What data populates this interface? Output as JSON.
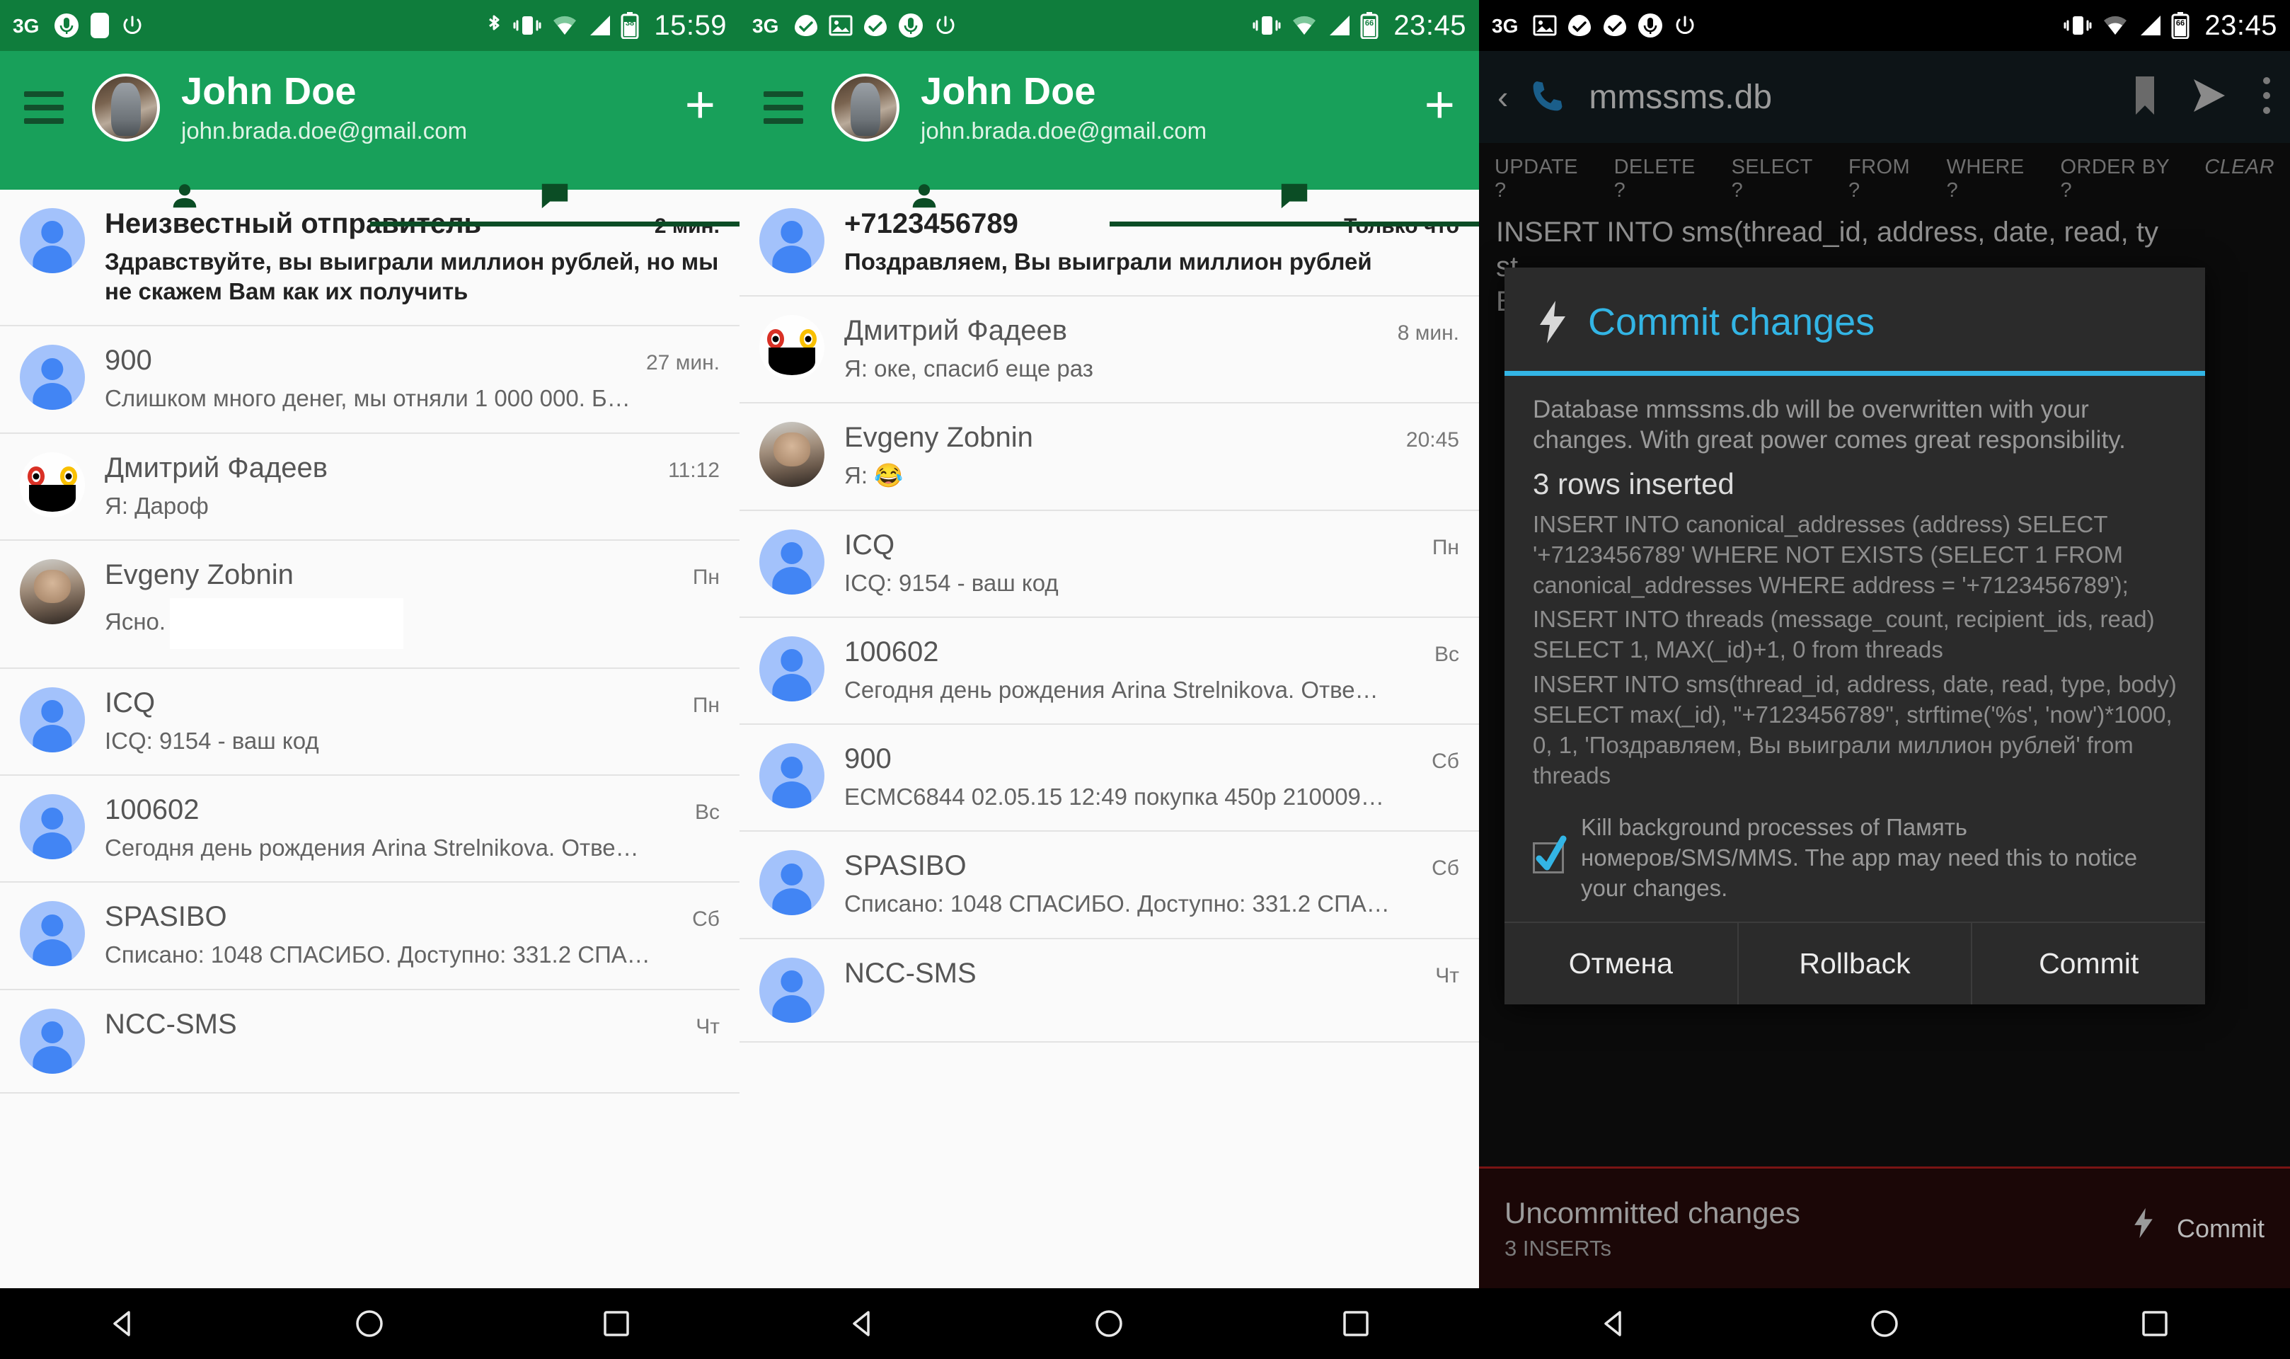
{
  "panel1": {
    "status_bar": {
      "time": "15:59",
      "battery_level": "38",
      "icons": [
        "3g-icon",
        "microphone-icon",
        "sim-card-icon",
        "power-icon",
        "bluetooth-icon",
        "vibrate-icon",
        "wifi-icon",
        "signal-icon",
        "battery-icon"
      ]
    },
    "header": {
      "name": "John Doe",
      "email": "john.brada.doe@gmail.com",
      "menu_icon": "hamburger-menu-icon",
      "add_icon": "plus-icon",
      "avatar": "user-avatar"
    },
    "tabs": [
      {
        "icon": "person-icon",
        "active": false
      },
      {
        "icon": "message-icon",
        "active": true
      }
    ],
    "messages": [
      {
        "sender": "Неизвестный отправитель",
        "time": "2 мин.",
        "snippet": "Здравствуйте, вы выиграли миллион рублей, но мы не скажем Вам как их получить",
        "unread": true,
        "avatar": "default-person-avatar",
        "wrap": true
      },
      {
        "sender": "900",
        "time": "27 мин.",
        "snippet": "Слишком много денег, мы отняли 1 000 000. Б…",
        "unread": false,
        "avatar": "default-person-avatar"
      },
      {
        "sender": "Дмитрий Фадеев",
        "time": "11:12",
        "snippet": "Я: Дароф",
        "unread": false,
        "avatar": "emoji-avatar"
      },
      {
        "sender": "Evgeny Zobnin",
        "time": "Пн",
        "snippet": "Ясно.",
        "unread": false,
        "avatar": "photo-avatar",
        "redacted": true
      },
      {
        "sender": "ICQ",
        "time": "Пн",
        "snippet": "ICQ: 9154 - ваш код",
        "unread": false,
        "avatar": "default-person-avatar"
      },
      {
        "sender": "100602",
        "time": "Вс",
        "snippet": "Сегодня день рождения Arina Strelnikova. Отве…",
        "unread": false,
        "avatar": "default-person-avatar"
      },
      {
        "sender": "SPASIBO",
        "time": "Сб",
        "snippet": "Списано: 1048 СПАСИБО. Доступно: 331.2 СПА…",
        "unread": false,
        "avatar": "default-person-avatar"
      },
      {
        "sender": "NCC-SMS",
        "time": "Чт",
        "snippet": "",
        "unread": false,
        "avatar": "default-person-avatar"
      }
    ]
  },
  "panel2": {
    "status_bar": {
      "time": "23:45",
      "battery_level": "66",
      "icons": [
        "3g-icon",
        "sync-icon",
        "image-icon",
        "sync-icon",
        "microphone-icon",
        "power-icon",
        "vibrate-icon",
        "wifi-icon",
        "signal-icon",
        "battery-icon"
      ]
    },
    "header": {
      "name": "John Doe",
      "email": "john.brada.doe@gmail.com",
      "menu_icon": "hamburger-menu-icon",
      "add_icon": "plus-icon",
      "avatar": "user-avatar"
    },
    "tabs": [
      {
        "icon": "person-icon",
        "active": false
      },
      {
        "icon": "message-icon",
        "active": true
      }
    ],
    "messages": [
      {
        "sender": "+7123456789",
        "time": "Только что",
        "snippet": "Поздравляем, Вы выиграли миллион рублей",
        "unread": true,
        "avatar": "default-person-avatar"
      },
      {
        "sender": "Дмитрий Фадеев",
        "time": "8 мин.",
        "snippet": "Я: оке, спасиб еще раз",
        "unread": false,
        "avatar": "emoji-avatar"
      },
      {
        "sender": "Evgeny Zobnin",
        "time": "20:45",
        "snippet": "Я: 😂",
        "unread": false,
        "avatar": "photo-avatar"
      },
      {
        "sender": "ICQ",
        "time": "Пн",
        "snippet": "ICQ: 9154 - ваш код",
        "unread": false,
        "avatar": "default-person-avatar"
      },
      {
        "sender": "100602",
        "time": "Вс",
        "snippet": "Сегодня день рождения Arina Strelnikova. Отве…",
        "unread": false,
        "avatar": "default-person-avatar"
      },
      {
        "sender": "900",
        "time": "Сб",
        "snippet": "ECMC6844 02.05.15 12:49 покупка 450р 210009…",
        "unread": false,
        "avatar": "default-person-avatar"
      },
      {
        "sender": "SPASIBO",
        "time": "Сб",
        "snippet": "Списано: 1048 СПАСИБО. Доступно: 331.2 СПА…",
        "unread": false,
        "avatar": "default-person-avatar"
      },
      {
        "sender": "NCC-SMS",
        "time": "Чт",
        "snippet": "",
        "unread": false,
        "avatar": "default-person-avatar"
      }
    ]
  },
  "panel3": {
    "status_bar": {
      "time": "23:45",
      "battery_level": "66",
      "icons": [
        "3g-icon",
        "image-icon",
        "sync-icon",
        "sync-icon",
        "microphone-icon",
        "power-icon",
        "vibrate-icon",
        "wifi-icon",
        "signal-icon",
        "battery-icon"
      ]
    },
    "appbar": {
      "back_icon": "back-chevron-icon",
      "app_icon": "phone-icon",
      "title": "mmssms.db",
      "actions": [
        "bookmark-icon",
        "run-icon",
        "overflow-menu-icon"
      ]
    },
    "query_hints": [
      "UPDATE ?",
      "DELETE ?",
      "SELECT ?",
      "FROM ?",
      "WHERE ?",
      "ORDER BY ?"
    ],
    "clear_label": "CLEAR",
    "editor_text": "INSERT INTO sms(thread_id, address, date, read, ty\nst\nBI",
    "dialog": {
      "icon": "bolt-icon",
      "title": "Commit changes",
      "description": "Database mmssms.db will be overwritten with your changes. With great power comes great responsibility.",
      "rows_inserted": "3 rows inserted",
      "sql": [
        "INSERT INTO canonical_addresses (address) SELECT '+7123456789' WHERE NOT EXISTS (SELECT 1 FROM canonical_addresses WHERE address = '+7123456789');",
        "INSERT INTO threads (message_count, recipient_ids, read) SELECT 1, MAX(_id)+1, 0 from threads",
        "INSERT INTO sms(thread_id, address, date, read, type, body) SELECT max(_id), \"+7123456789\", strftime('%s', 'now')*1000, 0, 1, 'Поздравляем, Вы выиграли миллион рублей' from threads"
      ],
      "checkbox": {
        "checked": true,
        "label": "Kill background processes of Память номеров/SMS/MMS. The app may need this to notice your changes."
      },
      "buttons": [
        "Отмена",
        "Rollback",
        "Commit"
      ]
    },
    "uncommitted": {
      "title": "Uncommitted changes",
      "subtitle": "3 INSERTs",
      "action_label": "Commit",
      "action_icon": "bolt-icon"
    }
  },
  "navbar": {
    "back_icon": "nav-back-triangle-icon",
    "home_icon": "nav-home-circle-icon",
    "recents_icon": "nav-recents-square-icon"
  }
}
